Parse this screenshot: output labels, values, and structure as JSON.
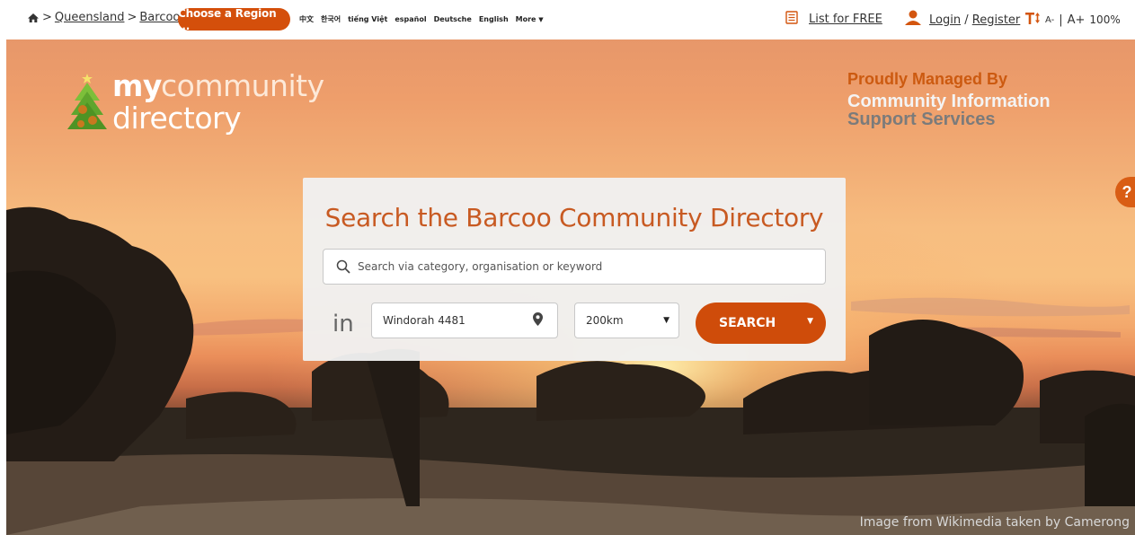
{
  "topbar": {
    "breadcrumb": {
      "sep1": ">",
      "state": "Queensland",
      "sep2": ">",
      "region": "Barcoo"
    },
    "choose_region": "Choose a Region ...",
    "languages": [
      "中文",
      "한국어",
      "tiếng Việt",
      "español",
      "Deutsche",
      "English"
    ],
    "more": "More",
    "list_free": "List for FREE",
    "login": "Login",
    "slash": "/",
    "register": "Register",
    "font_minus": "A-",
    "font_sep": "|",
    "font_plus": "A+",
    "zoom": "100%"
  },
  "logo": {
    "my": "my",
    "community": "community",
    "directory": "directory"
  },
  "managed": {
    "by": "Proudly Managed By",
    "org_line1": "Community Information",
    "org_line2": "Support Services"
  },
  "help": "?",
  "search": {
    "title": "Search the Barcoo Community Directory",
    "placeholder": "Search via category, organisation or keyword",
    "in_label": "in",
    "location": "Windorah 4481",
    "distance": "200km",
    "button": "SEARCH"
  },
  "credit": "Image from Wikimedia taken by Camerong",
  "colors": {
    "accent": "#cf4c0a",
    "title": "#c85a22"
  }
}
